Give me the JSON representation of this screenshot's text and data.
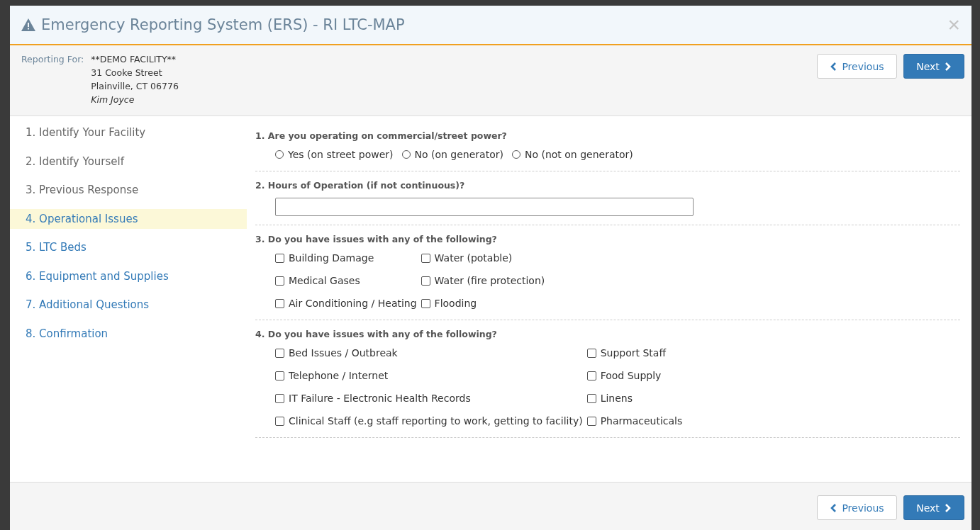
{
  "window": {
    "title": "Emergency Reporting System (ERS) - RI LTC-MAP",
    "close": "×"
  },
  "reporting_for": {
    "label": "Reporting For:",
    "facility": "**DEMO FACILITY**",
    "street": "31 Cooke Street",
    "city": "Plainville, CT 06776",
    "contact": "Kim Joyce"
  },
  "nav_buttons_top": {
    "previous": "Previous",
    "next": "Next"
  },
  "steps": [
    {
      "label": "1. Identify Your Facility",
      "completed": true,
      "selected": false
    },
    {
      "label": "2. Identify Yourself",
      "completed": true,
      "selected": false
    },
    {
      "label": "3. Previous Response",
      "completed": true,
      "selected": false
    },
    {
      "label": "4. Operational Issues",
      "completed": false,
      "selected": true
    },
    {
      "label": "5. LTC Beds",
      "completed": false,
      "selected": false
    },
    {
      "label": "6. Equipment and Supplies",
      "completed": false,
      "selected": false
    },
    {
      "label": "7. Additional Questions",
      "completed": false,
      "selected": false
    },
    {
      "label": "8. Confirmation",
      "completed": false,
      "selected": false
    }
  ],
  "questions": [
    {
      "kind": "radio",
      "label": "1. Are you operating on commercial/street power?",
      "options": [
        {
          "label": "Yes (on street power)",
          "selected": false
        },
        {
          "label": "No (on generator)",
          "selected": false
        },
        {
          "label": "No (not on generator)",
          "selected": false
        }
      ]
    },
    {
      "kind": "text",
      "label": "2. Hours of Operation (if not continuous)?"
    },
    {
      "kind": "checkbox",
      "label": "3. Do you have issues with any of the following?",
      "options": [
        {
          "label": "Building Damage",
          "checked": false
        },
        {
          "label": "Water (potable)",
          "checked": false
        },
        {
          "label": "Medical Gases",
          "checked": false
        },
        {
          "label": "Water (fire protection)",
          "checked": false
        },
        {
          "label": "Air Conditioning / Heating",
          "checked": false
        },
        {
          "label": "Flooding",
          "checked": false
        }
      ]
    },
    {
      "kind": "checkbox",
      "label": "4. Do you have issues with any of the following?",
      "options": [
        {
          "label": "Bed Issues / Outbreak",
          "checked": false
        },
        {
          "label": "Support Staff",
          "checked": false
        },
        {
          "label": "Telephone / Internet",
          "checked": false
        },
        {
          "label": "Food Supply",
          "checked": false
        },
        {
          "label": "IT Failure - Electronic Health Records",
          "checked": false
        },
        {
          "label": "Linens",
          "checked": false
        },
        {
          "label": "Clinical Staff (e.g staff reporting to work, getting to facility)",
          "checked": false
        },
        {
          "label": "Pharmaceuticals",
          "checked": false
        }
      ]
    }
  ],
  "nav_buttons_bottom": {
    "previous": "Previous",
    "next": "Next"
  }
}
